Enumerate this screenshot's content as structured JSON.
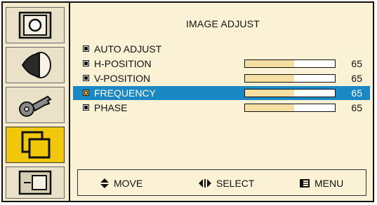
{
  "menu": {
    "title": "IMAGE ADJUST",
    "selected_item": "FREQUENCY",
    "items": [
      {
        "label": "AUTO ADJUST"
      },
      {
        "label": "H-POSITION",
        "value": "65",
        "level": 0.55
      },
      {
        "label": "V-POSITION",
        "value": "65",
        "level": 0.55
      },
      {
        "label": "FREQUENCY",
        "value": "65",
        "level": 0.55
      },
      {
        "label": "PHASE",
        "value": "65",
        "level": 0.55
      }
    ]
  },
  "footer": {
    "move_label": "MOVE",
    "select_label": "SELECT",
    "menu_label": "MENU"
  },
  "sidebar": {
    "icons": [
      "picture-icon",
      "color-icon",
      "key-icon",
      "image-adjust-icon",
      "position-icon"
    ],
    "active_index": 3
  },
  "colors": {
    "background": "#fbf1d4",
    "selection": "#1b88c6",
    "active_icon": "#f1c70c",
    "bar_fill": "#f6dfa3"
  }
}
